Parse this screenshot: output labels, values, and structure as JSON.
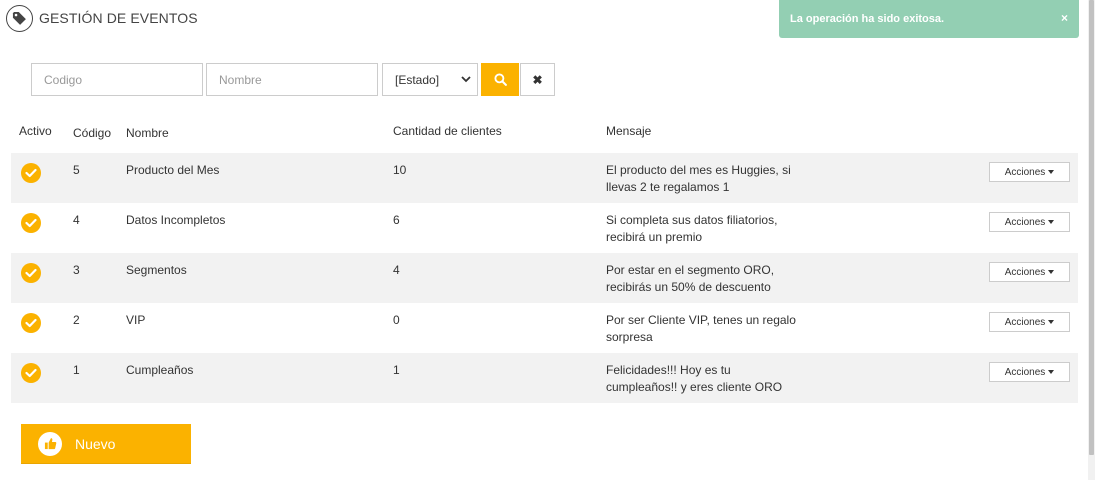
{
  "page": {
    "title": "GESTIÓN DE EVENTOS",
    "title_icon": "tag-icon"
  },
  "toast": {
    "message": "La operación ha sido exitosa.",
    "close": "×",
    "color": "#93cfb3"
  },
  "filters": {
    "codigo_placeholder": "Codigo",
    "nombre_placeholder": "Nombre",
    "estado_selected": "[Estado]",
    "search_icon": "search-icon",
    "clear_label": "✖"
  },
  "table": {
    "columns": {
      "activo": "Activo",
      "codigo": "Código",
      "nombre": "Nombre",
      "cantidad": "Cantidad de clientes",
      "mensaje": "Mensaje"
    },
    "rows": [
      {
        "active": true,
        "codigo": "5",
        "nombre": "Producto del Mes",
        "cantidad": "10",
        "mensaje_1": "El producto del mes es Huggies, si",
        "mensaje_2": "llevas 2 te regalamos 1",
        "acciones": "Acciones"
      },
      {
        "active": true,
        "codigo": "4",
        "nombre": "Datos Incompletos",
        "cantidad": "6",
        "mensaje_1": "Si completa sus datos filiatorios,",
        "mensaje_2": "recibirá un premio",
        "acciones": "Acciones"
      },
      {
        "active": true,
        "codigo": "3",
        "nombre": "Segmentos",
        "cantidad": "4",
        "mensaje_1": "Por estar en el segmento ORO,",
        "mensaje_2": "recibirás un 50% de descuento",
        "acciones": "Acciones"
      },
      {
        "active": true,
        "codigo": "2",
        "nombre": "VIP",
        "cantidad": "0",
        "mensaje_1": "Por ser Cliente VIP, tenes un regalo",
        "mensaje_2": "sorpresa",
        "acciones": "Acciones"
      },
      {
        "active": true,
        "codigo": "1",
        "nombre": "Cumpleaños",
        "cantidad": "1",
        "mensaje_1": "Felicidades!!! Hoy es tu",
        "mensaje_2": "cumpleaños!! y eres cliente ORO",
        "acciones": "Acciones"
      }
    ]
  },
  "nuevo_button": {
    "label": "Nuevo",
    "icon": "thumbs-up-icon"
  },
  "colors": {
    "accent": "#fbb200",
    "row_alt": "#f2f2f2"
  }
}
